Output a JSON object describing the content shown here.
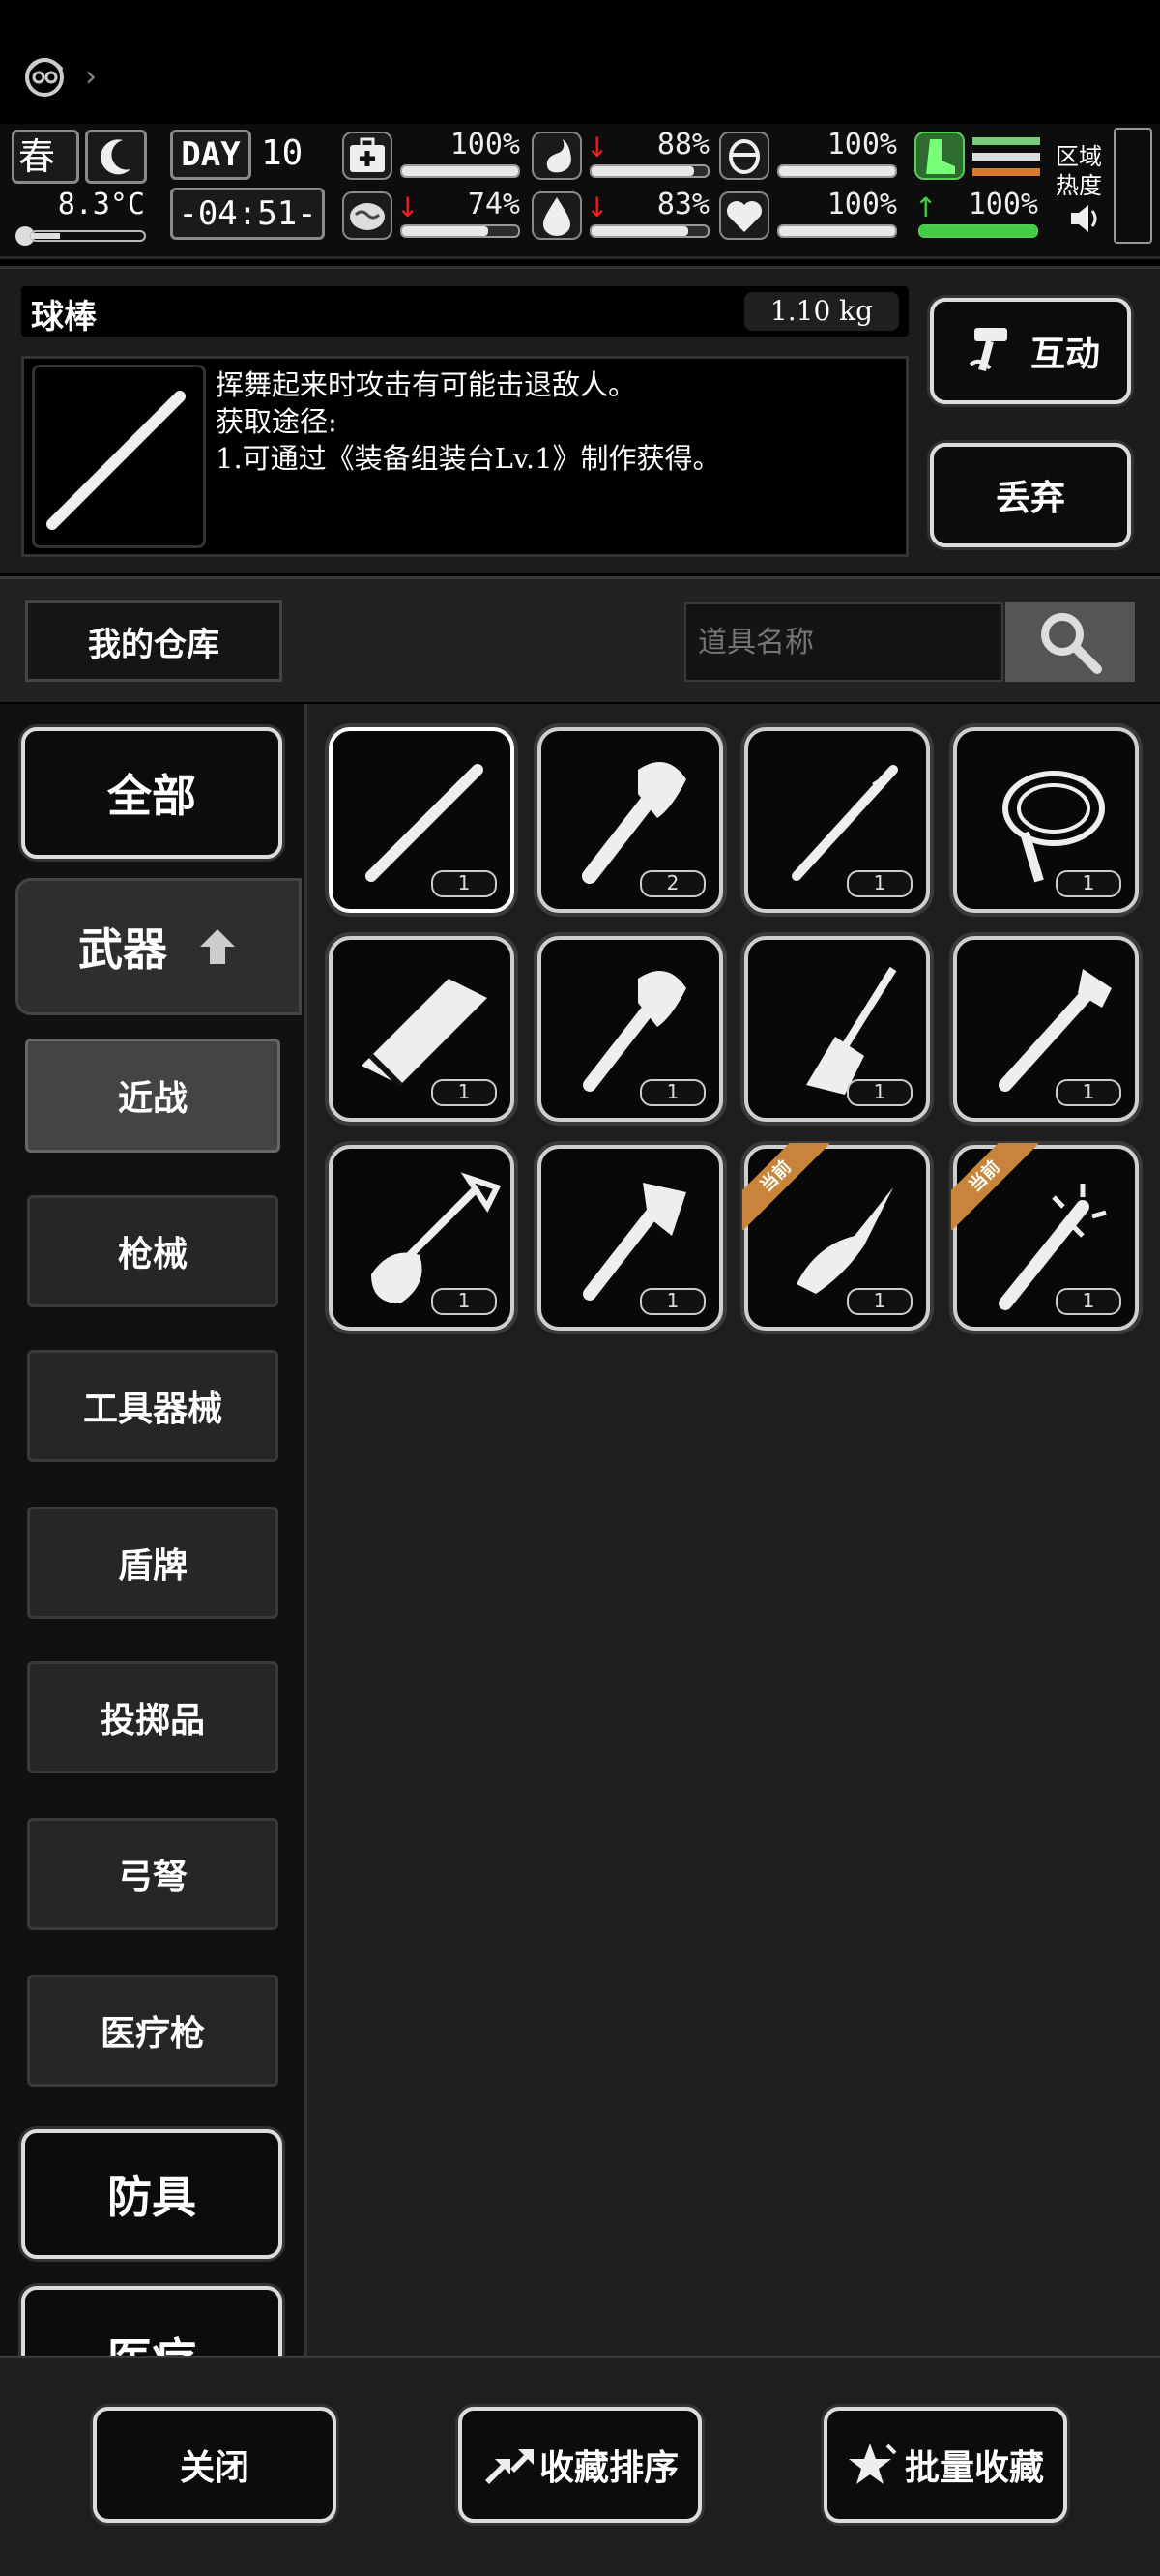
{
  "status": {
    "season": "春",
    "temperature": "8.3°C",
    "day_label": "DAY",
    "day_number": "10",
    "time": "-04:51-",
    "health": {
      "value": "100%",
      "fill": 1.0
    },
    "stomach": {
      "value": "88%",
      "fill": 0.88
    },
    "stamina": {
      "value": "100%",
      "fill": 1.0
    },
    "brain": {
      "value": "74%",
      "fill": 0.74
    },
    "water": {
      "value": "83%",
      "fill": 0.83
    },
    "heart": {
      "value": "100%",
      "fill": 1.0
    },
    "speed": {
      "value": "100%",
      "fill": 1.0
    },
    "zone_heat_label_1": "区域",
    "zone_heat_label_2": "热度"
  },
  "detail": {
    "item_name": "球棒",
    "weight": "1.10 kg",
    "desc_line1": "挥舞起来时攻击有可能击退敌人。",
    "desc_line2": "获取途径:",
    "desc_line3": "1.可通过《装备组装台Lv.1》制作获得。",
    "interact_label": "互动",
    "discard_label": "丢弃"
  },
  "storage": {
    "title": "我的仓库",
    "search_placeholder": "道具名称"
  },
  "categories": {
    "all": "全部",
    "weapons": "武器",
    "melee": "近战",
    "firearms": "枪械",
    "tools": "工具器械",
    "shield": "盾牌",
    "throwables": "投掷品",
    "bows": "弓弩",
    "medgun": "医疗枪",
    "armor": "防具",
    "medical": "医疗"
  },
  "items": [
    {
      "icon": "baseball-bat-icon",
      "qty": "1"
    },
    {
      "icon": "axe-icon",
      "qty": "2"
    },
    {
      "icon": "spear-icon",
      "qty": "1"
    },
    {
      "icon": "whip-icon",
      "qty": "1"
    },
    {
      "icon": "chainsaw-icon",
      "qty": "1"
    },
    {
      "icon": "hatchet-icon",
      "qty": "1"
    },
    {
      "icon": "chisel-icon",
      "qty": "1"
    },
    {
      "icon": "pipe-wrench-icon",
      "qty": "1"
    },
    {
      "icon": "shovel-icon",
      "qty": "1"
    },
    {
      "icon": "tomahawk-icon",
      "qty": "1"
    },
    {
      "icon": "folding-knife-icon",
      "qty": "1",
      "tag": "当前"
    },
    {
      "icon": "spiked-club-icon",
      "qty": "1",
      "tag": "当前"
    }
  ],
  "bottom": {
    "close": "关闭",
    "sort": "收藏排序",
    "batch": "批量收藏"
  }
}
